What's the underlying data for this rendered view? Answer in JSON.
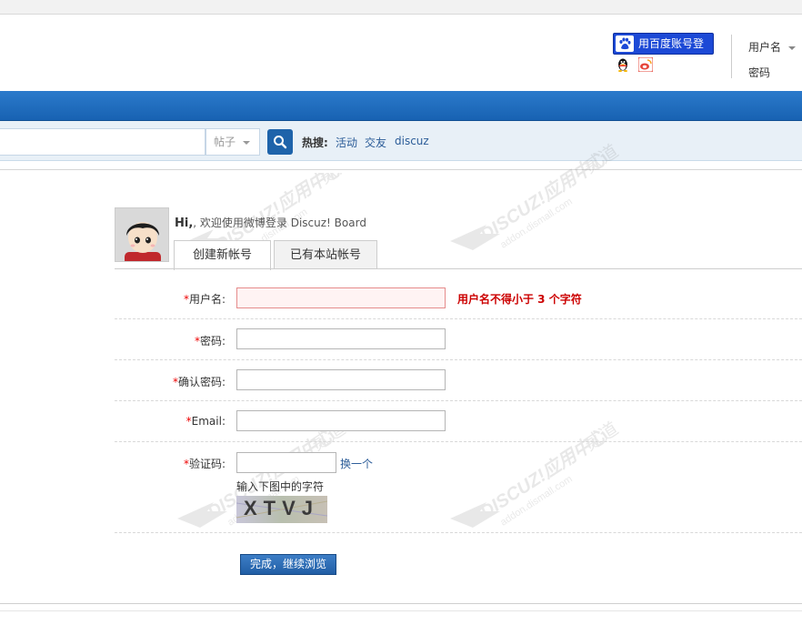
{
  "header": {
    "baidu_login_label": "用百度账号登录",
    "qq_icon": "qq-penguin-icon",
    "weibo_icon": "weibo-icon",
    "login_username_label": "用户名",
    "login_password_label": "密码"
  },
  "search": {
    "type_label": "帖子",
    "hot_label": "热搜:",
    "hot_links": [
      "活动",
      "交友",
      "discuz"
    ]
  },
  "register": {
    "greeting_hi": "Hi,",
    "greeting_text": ", 欢迎使用微博登录 Discuz! Board",
    "tabs": [
      "创建新帐号",
      "已有本站帐号"
    ],
    "fields": [
      {
        "label": "用户名:",
        "required": true
      },
      {
        "label": "密码:",
        "required": true
      },
      {
        "label": "确认密码:",
        "required": true
      },
      {
        "label": "Email:",
        "required": true
      }
    ],
    "username_error": "用户名不得小于 3 个字符",
    "captcha_label": "验证码:",
    "captcha_change": "换一个",
    "captcha_hint": "输入下图中的字符",
    "captcha_text": "XTVJ",
    "submit_label": "完成，继续浏览"
  },
  "watermark": {
    "brand": "DISCUZ!应用中心",
    "site": "addon.dismall.com",
    "mark": "贰道"
  },
  "colors": {
    "nav_blue": "#1862b2",
    "link_blue": "#2b5c98",
    "error_red": "#cc0000",
    "baidu_blue": "#1c49d6"
  }
}
